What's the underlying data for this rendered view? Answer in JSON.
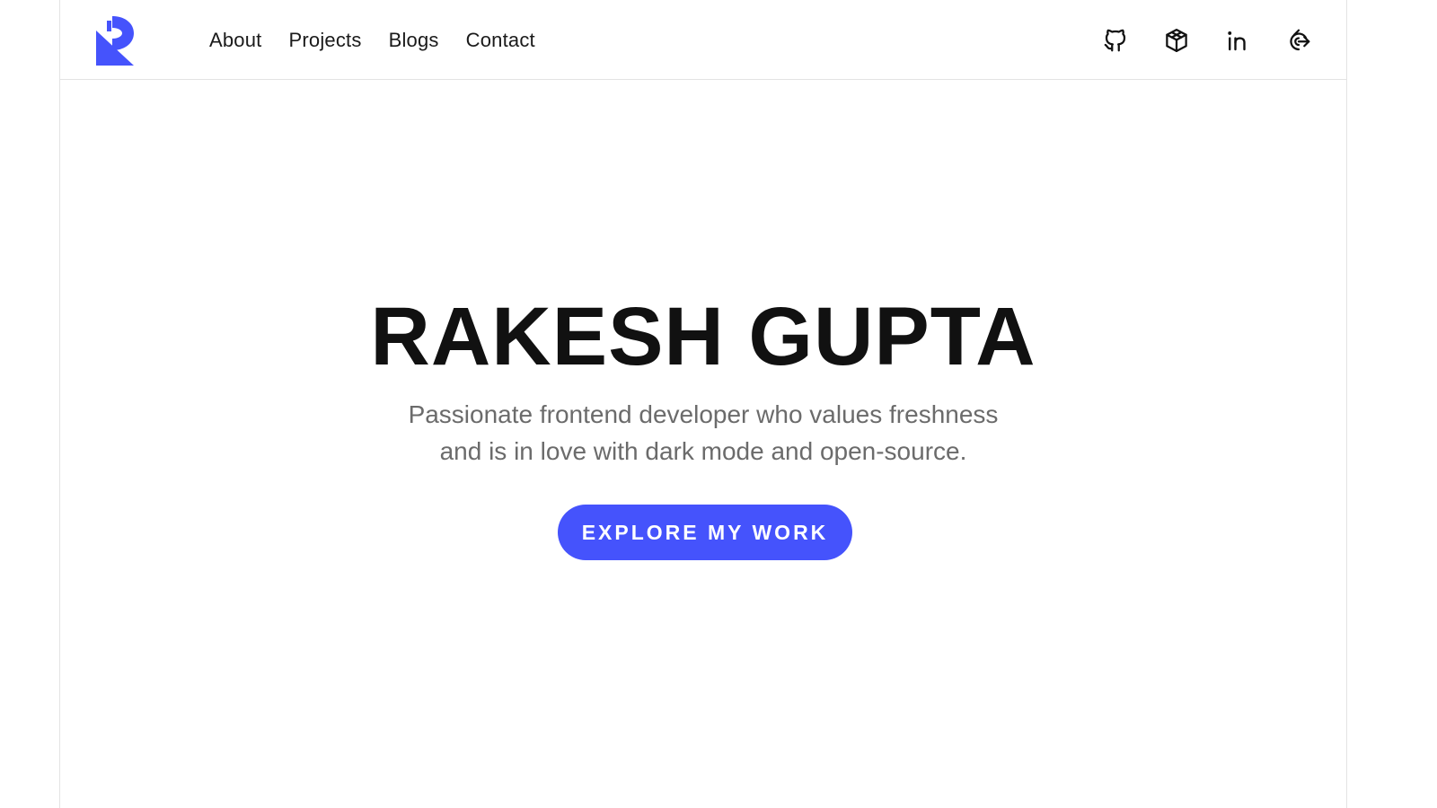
{
  "brand": {
    "logo_icon": "rg-monogram-logo",
    "accent_color": "#4553fc"
  },
  "nav": {
    "items": [
      {
        "label": "About"
      },
      {
        "label": "Projects"
      },
      {
        "label": "Blogs"
      },
      {
        "label": "Contact"
      }
    ]
  },
  "social": {
    "icons": [
      "github-icon",
      "codepen-icon",
      "linkedin-icon",
      "hashnode-icon"
    ]
  },
  "hero": {
    "title": "RAKESH GUPTA",
    "tagline_line1": "Passionate frontend developer who values freshness",
    "tagline_line2": "and is in love with dark mode and open-source.",
    "cta_label": "EXPLORE MY WORK"
  }
}
